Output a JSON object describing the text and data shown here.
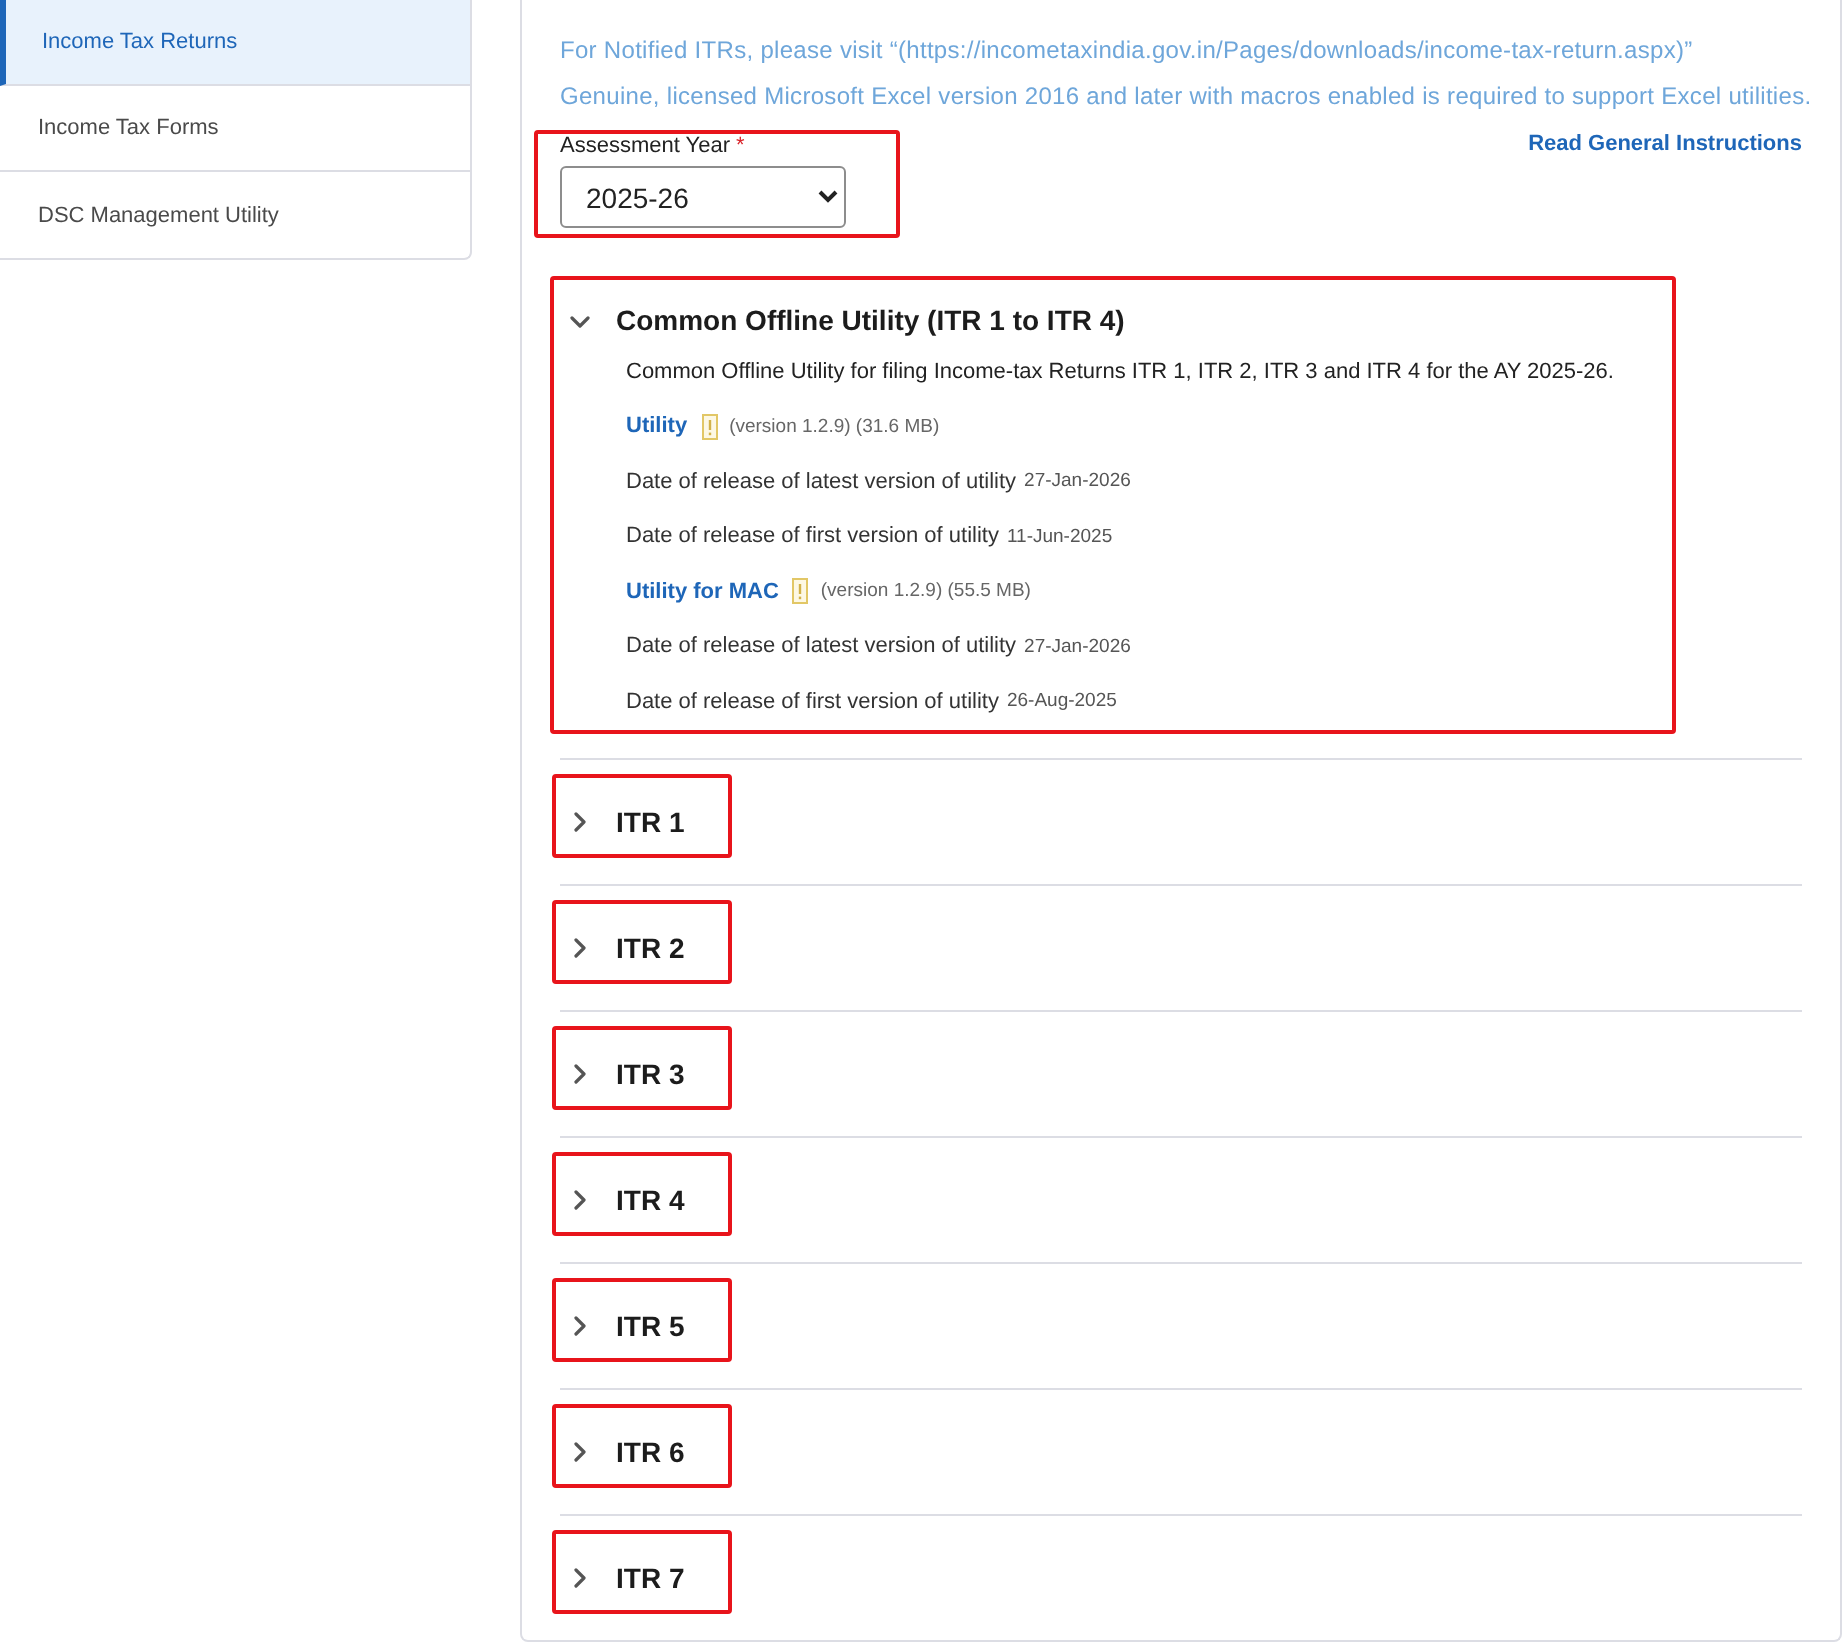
{
  "sidebar": {
    "items": [
      {
        "label": "Income Tax Returns",
        "selected": true
      },
      {
        "label": "Income Tax Forms",
        "selected": false
      },
      {
        "label": "DSC Management Utility",
        "selected": false
      }
    ]
  },
  "notices": [
    "For Notified ITRs, please visit “(https://incometaxindia.gov.in/Pages/downloads/income-tax-return.aspx)”",
    "Genuine, licensed Microsoft Excel version 2016 and later with macros enabled is required to support Excel utilities."
  ],
  "assessment_year": {
    "label": "Assessment Year",
    "required_mark": "*",
    "value": "2025-26",
    "highlighted": true
  },
  "instructions_link": "Read General Instructions",
  "accordions": [
    {
      "title": "Common Offline Utility (ITR 1 to ITR 4)",
      "expanded": true,
      "highlighted": true,
      "description": "Common Offline Utility for filing Income-tax Returns ITR 1, ITR 2, ITR 3 and ITR 4 for the AY 2025-26.",
      "entries": [
        {
          "kind": "download",
          "link": "Utility",
          "detail": "(version 1.2.9) (31.6 MB)"
        },
        {
          "kind": "date",
          "label": "Date of release of latest version of utility",
          "value": "27-Jan-2026"
        },
        {
          "kind": "date",
          "label": "Date of release of first version of utility",
          "value": "11-Jun-2025"
        },
        {
          "kind": "download",
          "link": "Utility for MAC",
          "detail": "(version 1.2.9) (55.5 MB)"
        },
        {
          "kind": "date",
          "label": "Date of release of latest version of utility",
          "value": "27-Jan-2026"
        },
        {
          "kind": "date",
          "label": "Date of release of first version of utility",
          "value": "26-Aug-2025"
        }
      ]
    },
    {
      "title": "ITR 1",
      "expanded": false,
      "highlighted": true
    },
    {
      "title": "ITR 2",
      "expanded": false,
      "highlighted": true
    },
    {
      "title": "ITR 3",
      "expanded": false,
      "highlighted": true
    },
    {
      "title": "ITR 4",
      "expanded": false,
      "highlighted": true
    },
    {
      "title": "ITR 5",
      "expanded": false,
      "highlighted": true
    },
    {
      "title": "ITR 6",
      "expanded": false,
      "highlighted": true
    },
    {
      "title": "ITR 7",
      "expanded": false,
      "highlighted": true
    }
  ]
}
